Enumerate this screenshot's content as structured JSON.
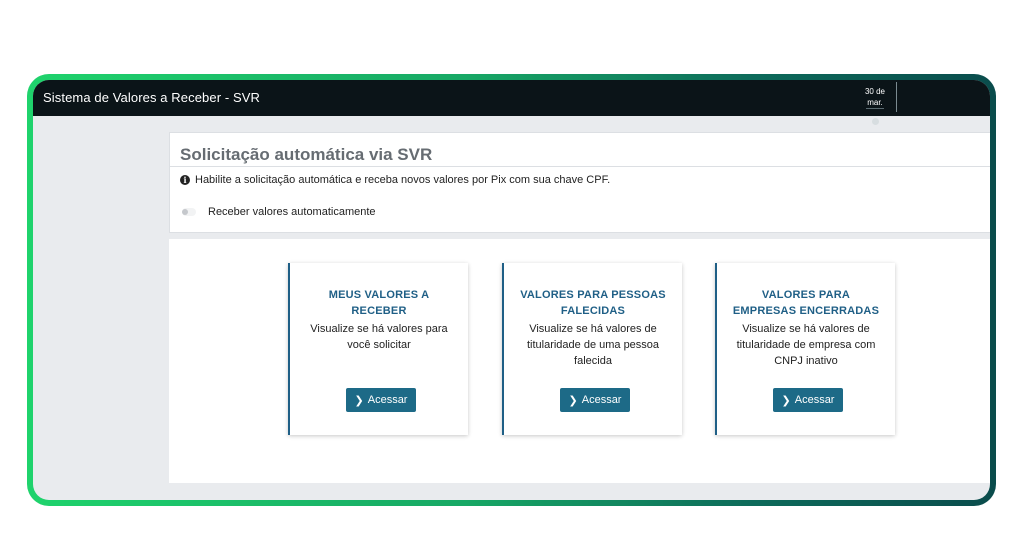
{
  "header": {
    "app_title": "Sistema de Valores a Receber - SVR",
    "date_day": "30 de",
    "date_month": "mar."
  },
  "auto_request": {
    "title": "Solicitação automática via SVR",
    "info_icon": "info-circle-icon",
    "info_text": "Habilite a solicitação automática e receba novos valores por Pix com sua chave CPF.",
    "toggle_label": "Receber valores automaticamente",
    "toggle_on": false
  },
  "cards": [
    {
      "title": "MEUS VALORES A RECEBER",
      "description": "Visualize se há valores para você solicitar",
      "button_label": "Acessar"
    },
    {
      "title": "VALORES PARA PESSOAS FALECIDAS",
      "description": "Visualize se há valores de titularidade de uma pessoa falecida",
      "button_label": "Acessar"
    },
    {
      "title": "VALORES PARA EMPRESAS ENCERRADAS",
      "description": "Visualize se há valores de titularidade de empresa com CNPJ inativo",
      "button_label": "Acessar"
    }
  ],
  "colors": {
    "topbar": "#0b1418",
    "accent": "#1f5f86",
    "button": "#1d6a87",
    "frame_start": "#1fd36c",
    "frame_end": "#0a4c4c"
  }
}
